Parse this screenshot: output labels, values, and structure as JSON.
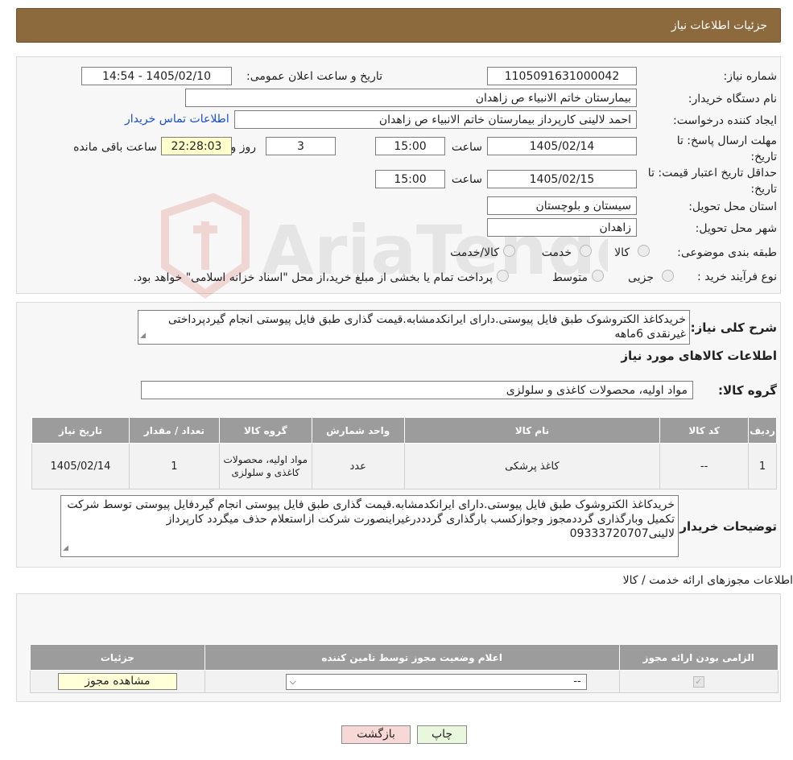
{
  "header": {
    "title": "جزئیات اطلاعات نیاز"
  },
  "form": {
    "need_number_label": "شماره نیاز:",
    "need_number": "1105091631000042",
    "announce_label": "تاریخ و ساعت اعلان عمومی:",
    "announce_value": "1405/02/10 - 14:54",
    "buyer_org_label": "نام دستگاه خریدار:",
    "buyer_org": "بیمارستان خاتم الانبیاء  ص  زاهدان",
    "requester_label": "ایجاد کننده درخواست:",
    "requester": "احمد لالینی کارپرداز بیمارستان خاتم الانبیاء  ص  زاهدان",
    "contact_link": "اطلاعات تماس خریدار",
    "deadline_label": "مهلت ارسال پاسخ: تا تاریخ:",
    "deadline_date": "1405/02/14",
    "time_label": "ساعت",
    "deadline_time": "15:00",
    "days_value": "3",
    "days_label": "روز و",
    "remaining_time": "22:28:03",
    "remaining_label": "ساعت باقی مانده",
    "validity_label": "حداقل تاریخ اعتبار قیمت: تا تاریخ:",
    "validity_date": "1405/02/15",
    "validity_time": "15:00",
    "province_label": "استان محل تحویل:",
    "province": "سیستان و بلوچستان",
    "city_label": "شهر محل تحویل:",
    "city": "زاهدان",
    "category_label": "طبقه بندی موضوعی:",
    "category_options": [
      "کالا",
      "خدمت",
      "کالا/خدمت"
    ],
    "purchase_type_label": "نوع فرآیند خرید :",
    "purchase_options": [
      "جزیی",
      "متوسط"
    ],
    "purchase_note": "پرداخت تمام یا بخشی از مبلغ خرید،از محل \"اسناد خزانه اسلامی\" خواهد بود."
  },
  "description": {
    "label": "شرح کلی نیاز:",
    "text": "خریدکاغذ الکتروشوک طبق فایل پیوستی.دارای ایرانکدمشابه.قیمت گذاری طبق فایل پیوستی انجام گیردپرداختی غیرنقدی 6ماهه",
    "goods_info_title": "اطلاعات کالاهای مورد نیاز",
    "goods_group_label": "گروه کالا:",
    "goods_group": "مواد اولیه، محصولات کاغذی و سلولزی"
  },
  "goods_table": {
    "headers": [
      "ردیف",
      "کد کالا",
      "نام کالا",
      "واحد شمارش",
      "گروه کالا",
      "تعداد / مقدار",
      "تاریخ نیاز"
    ],
    "rows": [
      [
        "1",
        "--",
        "کاغذ پرشکی",
        "عدد",
        "مواد اولیه، محصولات کاغذی و سلولزی",
        "1",
        "1405/02/14"
      ]
    ]
  },
  "buyer_notes": {
    "label": "توضیحات خریدار:",
    "text": "خریدکاغذ الکتروشوک طبق فایل پیوستی.دارای ایرانکدمشابه.قیمت گذاری طبق فایل پیوستی انجام گیردفایل پیوستی توسط شرکت تکمیل وبارگذاری گرددمجوز وجوازکسب بارگذاری گردددرغیراینصورت شرکت ازاستعلام حذف میگردد کارپرداز لالینی09333720707"
  },
  "permits": {
    "title": "اطلاعات مجوزهای ارائه خدمت / کالا",
    "headers": [
      "الزامی بودن ارائه مجوز",
      "اعلام وضعیت مجوز توسط تامین کننده",
      "جزئیات"
    ],
    "select_value": "--",
    "view_button": "مشاهده مجوز"
  },
  "buttons": {
    "print": "چاپ",
    "back": "بازگشت"
  },
  "colors": {
    "header": "#8c6a3e",
    "table_header": "#9c9c9c",
    "link": "#1a4fc7",
    "back_button": "#f8d7d7",
    "print_button": "#e9f7dc"
  }
}
